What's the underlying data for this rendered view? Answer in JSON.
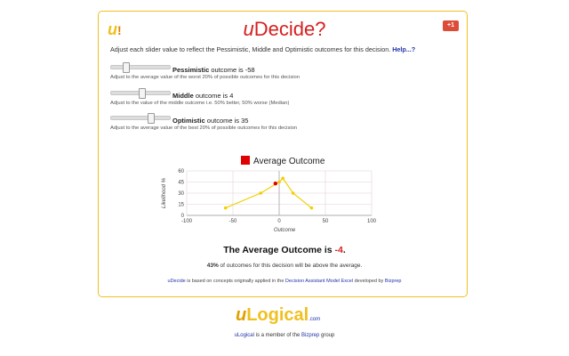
{
  "header": {
    "title_u": "u",
    "title_rest": "Decide?",
    "gplus_label": "+1"
  },
  "intro": {
    "text": "Adjust each slider value to reflect the Pessimistic, Middle and Optimistic outcomes for this decision.",
    "help": "Help...?"
  },
  "sliders": [
    {
      "name": "Pessimistic",
      "suffix": " outcome is ",
      "value": "-58",
      "desc": "Adjust to the average value of the worst 20% of possible outcomes for this decision",
      "level": -58
    },
    {
      "name": "Middle",
      "suffix": " outcome is ",
      "value": "4",
      "desc": "Adjust to the value of the middle outcome i.e. 50% better, 50% worse (Median)",
      "level": 4
    },
    {
      "name": "Optimistic",
      "suffix": " outcome is ",
      "value": "35",
      "desc": "Adjust to the average value of the best 20% of possible outcomes for this decision",
      "level": 35
    }
  ],
  "chart_data": {
    "type": "line",
    "series": [
      {
        "name": "",
        "x": [
          -58,
          -20,
          0,
          4,
          15,
          35
        ],
        "y": [
          10,
          30,
          45,
          50,
          30,
          10
        ],
        "color": "#f0d000"
      }
    ],
    "marker": {
      "name": "Average Outcome",
      "x": -4,
      "y": 43,
      "color": "#e00000"
    },
    "xlabel": "Outcome",
    "ylabel": "Likelihood %",
    "xlim": [
      -100,
      100
    ],
    "ylim": [
      0,
      60
    ],
    "xticks": [
      "-100",
      "-50",
      "0",
      "50",
      "100"
    ],
    "yticks": [
      "0",
      "15",
      "30",
      "45",
      "60"
    ],
    "grid": true
  },
  "legend": {
    "label": "Average Outcome",
    "color": "#e00000"
  },
  "result": {
    "prefix": "The Average Outcome is ",
    "value": "-4",
    "suffix": "."
  },
  "above": {
    "pct": "43%",
    "text": " of outcomes for this decision will be above the average."
  },
  "note": {
    "brand": "uDecide",
    "text1": " is based on concepts originally applied in the ",
    "link1": "Decision Assistant Model Excel",
    "text2": " developed by ",
    "link2": "Bizprep"
  },
  "footer": {
    "logo_u": "u",
    "logo_rest": "Logical",
    "logo_com": ".com",
    "member_brand": "uLogical",
    "member_text": " is a member of the ",
    "member_link": "Bizprep",
    "member_end": " group"
  }
}
